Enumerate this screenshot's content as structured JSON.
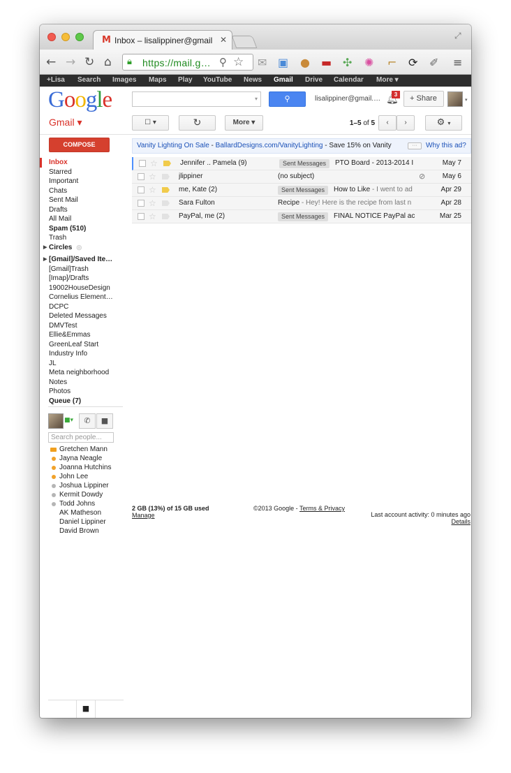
{
  "browser": {
    "tab_title": "Inbox – lisalippiner@gmail",
    "tab_close": "✕",
    "url": "https://mail.g…",
    "favicon": "M"
  },
  "gbar": {
    "items": [
      "+Lisa",
      "Search",
      "Images",
      "Maps",
      "Play",
      "YouTube",
      "News",
      "Gmail",
      "Drive",
      "Calendar",
      "More ▾"
    ],
    "active": "Gmail"
  },
  "header": {
    "logo": [
      "G",
      "o",
      "o",
      "g",
      "l",
      "e"
    ],
    "account": "lisalippiner@gmail.…",
    "notification_count": "3",
    "share_label": "Share"
  },
  "gmail": {
    "label": "Gmail ▾",
    "more_label": "More ▾",
    "page_range": "1–5",
    "page_of": "of",
    "page_total": "5",
    "compose_label": "COMPOSE"
  },
  "nav": {
    "items": [
      {
        "label": "Inbox",
        "style": "active"
      },
      {
        "label": "Starred",
        "style": ""
      },
      {
        "label": "Important",
        "style": ""
      },
      {
        "label": "Chats",
        "style": ""
      },
      {
        "label": "Sent Mail",
        "style": ""
      },
      {
        "label": "Drafts",
        "style": ""
      },
      {
        "label": "All Mail",
        "style": ""
      },
      {
        "label": "Spam (510)",
        "style": "bold"
      },
      {
        "label": "Trash",
        "style": ""
      },
      {
        "label": "Circles",
        "style": "bold"
      },
      {
        "label": "[Gmail]/Saved Ite…",
        "style": "bold"
      },
      {
        "label": "[Gmail]Trash",
        "style": ""
      },
      {
        "label": "[Imap]/Drafts",
        "style": ""
      },
      {
        "label": "19002HouseDesign",
        "style": ""
      },
      {
        "label": "Cornelius Element…",
        "style": ""
      },
      {
        "label": "DCPC",
        "style": ""
      },
      {
        "label": "Deleted Messages",
        "style": ""
      },
      {
        "label": "DMVTest",
        "style": ""
      },
      {
        "label": "Ellie&Emmas",
        "style": ""
      },
      {
        "label": "GreenLeaf Start",
        "style": ""
      },
      {
        "label": "Industry Info",
        "style": ""
      },
      {
        "label": "JL",
        "style": ""
      },
      {
        "label": "Meta neighborhood",
        "style": ""
      },
      {
        "label": "Notes",
        "style": ""
      },
      {
        "label": "Photos",
        "style": ""
      },
      {
        "label": "Queue (7)",
        "style": "bold"
      }
    ]
  },
  "chat": {
    "search_placeholder": "Search people...",
    "contacts": [
      {
        "name": "Gretchen Mann",
        "status": "video"
      },
      {
        "name": "Jayna Neagle",
        "status": "away"
      },
      {
        "name": "Joanna Hutchins",
        "status": "away"
      },
      {
        "name": "John Lee",
        "status": "away"
      },
      {
        "name": "Joshua Lippiner",
        "status": "idle"
      },
      {
        "name": "Kermit Dowdy",
        "status": "idle"
      },
      {
        "name": "Todd Johns",
        "status": "idle"
      },
      {
        "name": "AK Matheson",
        "status": "none"
      },
      {
        "name": "Daniel Lippiner",
        "status": "none"
      },
      {
        "name": "David Brown",
        "status": "none"
      }
    ]
  },
  "ad": {
    "title": "Vanity Lighting On Sale",
    "url": "BallardDesigns.com/VanityLighting",
    "desc": "Save 15% on Vanity",
    "why": "Why this ad?"
  },
  "messages": [
    {
      "sender": "Jennifer .. Pamela (9)",
      "label": "Sent Messages",
      "subject": "PTO Board - 2013-2014 I",
      "snippet": "",
      "date": "May 7",
      "important": true,
      "attachment": false
    },
    {
      "sender": "jlippiner",
      "label": "",
      "subject": "(no subject)",
      "snippet": "",
      "date": "May 6",
      "important": false,
      "attachment": true
    },
    {
      "sender": "me, Kate (2)",
      "label": "Sent Messages",
      "subject": "How to Like",
      "snippet": " - I went to ad",
      "date": "Apr 29",
      "important": true,
      "attachment": false
    },
    {
      "sender": "Sara Fulton",
      "label": "",
      "subject": "Recipe",
      "snippet": " - Hey! Here is the recipe from last n",
      "date": "Apr 28",
      "important": false,
      "attachment": false
    },
    {
      "sender": "PayPal, me (2)",
      "label": "Sent Messages",
      "subject": "FINAL NOTICE PayPal ac",
      "snippet": "",
      "date": "Mar 25",
      "important": false,
      "attachment": false
    }
  ],
  "footer": {
    "storage": "2 GB (13%) of 15 GB used",
    "manage": "Manage",
    "copyright": "©2013 Google - ",
    "terms": "Terms & Privacy",
    "activity": "Last account activity: 0 minutes ago",
    "details": "Details"
  }
}
